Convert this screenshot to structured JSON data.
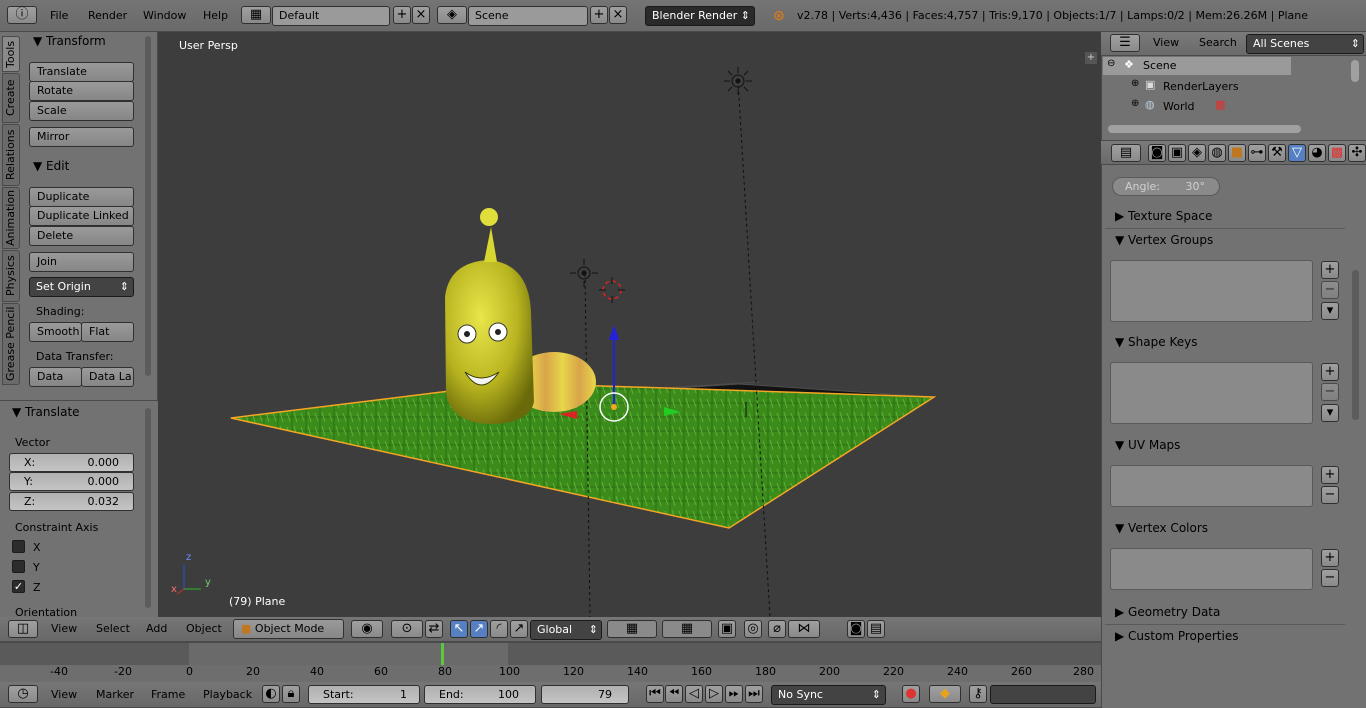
{
  "top_bar": {
    "menus": [
      "File",
      "Render",
      "Window",
      "Help"
    ],
    "layout_value": "Default",
    "scene_value": "Scene",
    "engine_value": "Blender Render",
    "status": "v2.78 | Verts:4,436 | Faces:4,757 | Tris:9,170 | Objects:1/7 | Lamps:0/2 | Mem:26.26M | Plane"
  },
  "tool_tabs": [
    "Tools",
    "Create",
    "Relations",
    "Animation",
    "Physics",
    "Grease Pencil"
  ],
  "tools_panel": {
    "transform_header": "Transform",
    "transform_buttons": [
      "Translate",
      "Rotate",
      "Scale"
    ],
    "mirror": "Mirror",
    "edit_header": "Edit",
    "edit_buttons": [
      "Duplicate",
      "Duplicate Linked",
      "Delete"
    ],
    "join": "Join",
    "set_origin": "Set Origin",
    "shading_label": "Shading:",
    "smooth": "Smooth",
    "flat": "Flat",
    "data_transfer_label": "Data Transfer:",
    "data": "Data",
    "data_la": "Data La"
  },
  "operator_panel": {
    "header": "Translate",
    "vector_label": "Vector",
    "x_label": "X:",
    "x_value": "0.000",
    "y_label": "Y:",
    "y_value": "0.000",
    "z_label": "Z:",
    "z_value": "0.032",
    "constraint_label": "Constraint Axis",
    "axes": [
      "X",
      "Y",
      "Z"
    ],
    "axes_checked": [
      false,
      false,
      true
    ],
    "orientation_label": "Orientation"
  },
  "viewport": {
    "view_label": "User Persp",
    "object_label": "(79) Plane",
    "axis_x": "x",
    "axis_y": "y",
    "axis_z": "z"
  },
  "viewport_header": {
    "menus": [
      "View",
      "Select",
      "Add",
      "Object"
    ],
    "mode": "Object Mode",
    "orientation": "Global"
  },
  "outliner": {
    "menus": [
      "View",
      "Search"
    ],
    "filter": "All Scenes",
    "items": [
      "Scene",
      "RenderLayers",
      "World"
    ]
  },
  "properties": {
    "angle_label": "Angle:",
    "angle_value": "30°",
    "panels": [
      "Texture Space",
      "Vertex Groups",
      "Shape Keys",
      "UV Maps",
      "Vertex Colors",
      "Geometry Data",
      "Custom Properties"
    ]
  },
  "timeline": {
    "ticks": [
      "-40",
      "-20",
      "0",
      "20",
      "40",
      "60",
      "80",
      "100",
      "120",
      "140",
      "160",
      "180",
      "200",
      "220",
      "240",
      "260",
      "280"
    ],
    "current_frame_marker": 79,
    "menus": [
      "View",
      "Marker",
      "Frame",
      "Playback"
    ],
    "start_label": "Start:",
    "start_value": "1",
    "end_label": "End:",
    "end_value": "100",
    "current_frame": "79",
    "sync": "No Sync"
  },
  "colors": {
    "header_bg": "#727272",
    "viewport_bg": "#3d3d3d",
    "panel_bg": "#727272",
    "grass": "#3a8a1a",
    "selection_orange": "#f5a623",
    "active_tab_blue": "#5680c2"
  }
}
